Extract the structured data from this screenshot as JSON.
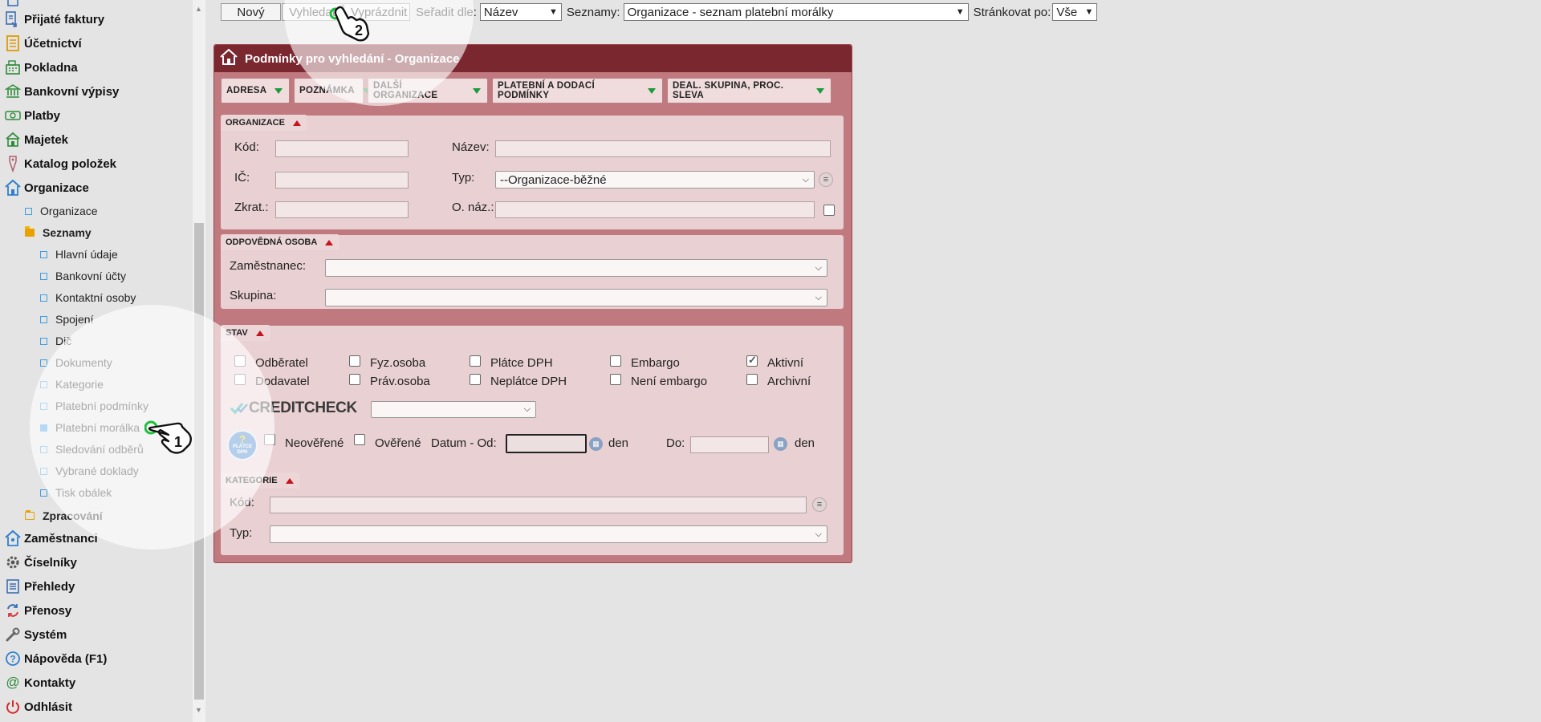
{
  "sidebar": {
    "top_items": [
      {
        "label": "Přijaté faktury",
        "icon": "invoice-in-icon"
      },
      {
        "label": "Účetnictví",
        "icon": "ledger-icon"
      },
      {
        "label": "Pokladna",
        "icon": "cash-register-icon"
      },
      {
        "label": "Bankovní výpisy",
        "icon": "bank-icon"
      },
      {
        "label": "Platby",
        "icon": "payment-icon"
      },
      {
        "label": "Majetek",
        "icon": "property-icon"
      },
      {
        "label": "Katalog položek",
        "icon": "catalog-tag-icon"
      },
      {
        "label": "Organizace",
        "icon": "house-icon"
      }
    ],
    "organizace_sub": {
      "organizace": "Organizace",
      "seznamy": "Seznamy",
      "seznamy_items": [
        "Hlavní údaje",
        "Bankovní účty",
        "Kontaktní osoby",
        "Spojení",
        "Dič",
        "Dokumenty",
        "Kategorie",
        "Platební podmínky",
        "Platební morálka",
        "Sledování odběrů",
        "Vybrané doklady",
        "Tisk obálek"
      ],
      "zpracovani": "Zpracování"
    },
    "bottom_items": [
      {
        "label": "Zaměstnanci",
        "icon": "employee-house-icon"
      },
      {
        "label": "Číselníky",
        "icon": "gear-icon"
      },
      {
        "label": "Přehledy",
        "icon": "list-icon"
      },
      {
        "label": "Přenosy",
        "icon": "sync-icon"
      },
      {
        "label": "Systém",
        "icon": "wrench-icon"
      },
      {
        "label": "Nápověda (F1)",
        "icon": "help-icon"
      },
      {
        "label": "Kontakty",
        "icon": "at-icon"
      },
      {
        "label": "Odhlásit",
        "icon": "power-icon"
      }
    ],
    "active_item": "Platební morálka"
  },
  "callouts": {
    "one": "1",
    "two": "2"
  },
  "toolbar": {
    "new_label": "Nový",
    "search_label": "Vyhledat",
    "clear_label": "Vyprázdnit",
    "sort_label": "Seřadit dle:",
    "sort_value": "Název",
    "lists_label": "Seznamy:",
    "lists_value": "Organizace - seznam platební morálky",
    "paging_label": "Stránkovat po:",
    "paging_value": "Vše"
  },
  "panel": {
    "title": "Podmínky pro vyhledání - Organizace",
    "tabs": [
      "ADRESA",
      "POZNÁMKA",
      "DALŠÍ ORGANIZACE",
      "PLATEBNÍ A DODACÍ PODMÍNKY",
      "DEAL. SKUPINA, PROC. SLEVA"
    ],
    "organizace": {
      "title": "ORGANIZACE",
      "kod_label": "Kód:",
      "nazev_label": "Název:",
      "ic_label": "IČ:",
      "typ_label": "Typ:",
      "typ_value": "--Organizace-běžné",
      "zkrat_label": "Zkrat.:",
      "o_naz_label": "O. náz.:"
    },
    "odpovedna": {
      "title": "ODPOVĚDNÁ OSOBA",
      "zamestnanec_label": "Zaměstnanec:",
      "skupina_label": "Skupina:"
    },
    "stav": {
      "title": "STAV",
      "checkboxes": [
        {
          "label": "Odběratel",
          "checked": false
        },
        {
          "label": "Fyz.osoba",
          "checked": false
        },
        {
          "label": "Plátce DPH",
          "checked": false
        },
        {
          "label": "Embargo",
          "checked": false
        },
        {
          "label": "Aktivní",
          "checked": true
        },
        {
          "label": "Dodavatel",
          "checked": false
        },
        {
          "label": "Práv.osoba",
          "checked": false
        },
        {
          "label": "Neplátce DPH",
          "checked": false
        },
        {
          "label": "Není embargo",
          "checked": false
        },
        {
          "label": "Archivní",
          "checked": false
        }
      ],
      "creditcheck_logo": "CREDITCHECK",
      "dph_badge": "PLÁTCE DPH",
      "neoverene_label": "Neověřené",
      "overene_label": "Ověřené",
      "datum_od_label": "Datum - Od:",
      "den_label": "den",
      "do_label": "Do:",
      "den2_label": "den"
    },
    "kategorie": {
      "title": "KATEGORIE",
      "kod_label": "Kód:",
      "typ_label": "Typ:"
    }
  },
  "colors": {
    "panel_header": "#7b2730",
    "panel_bg": "#c07a7f",
    "section_bg": "#e9d0d2",
    "accent_blue": "#3f9ee6",
    "tab_arrow": "#1a9a3a",
    "collapse_arrow": "#c4141c"
  }
}
